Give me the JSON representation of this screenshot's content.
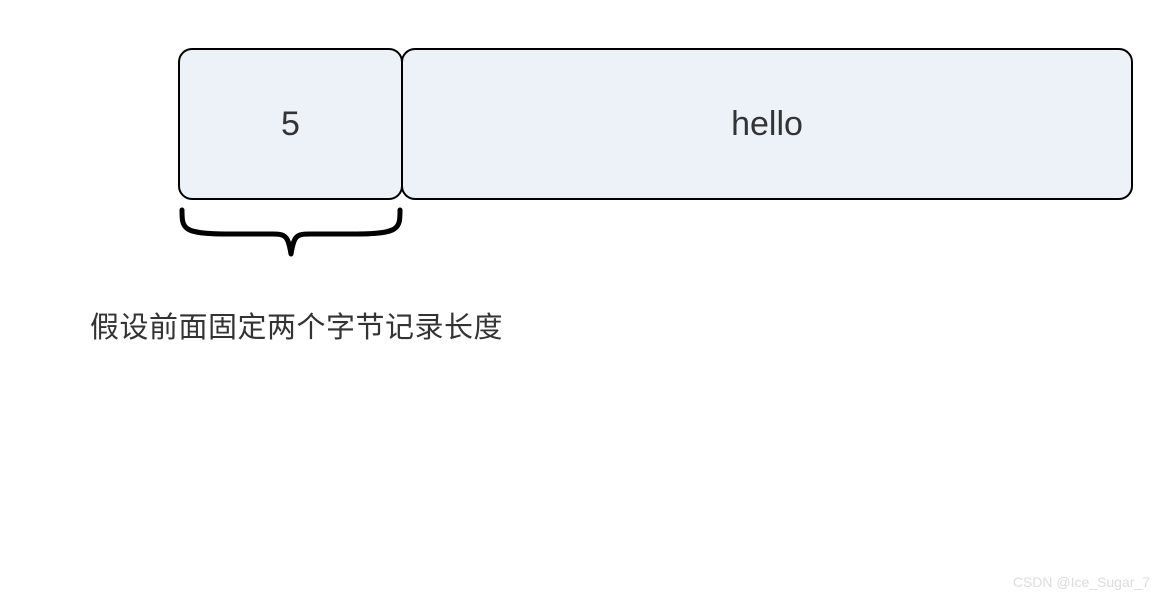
{
  "diagram": {
    "length_box": "5",
    "payload_box": "hello",
    "caption": "假设前面固定两个字节记录长度"
  },
  "watermark": "CSDN @Ice_Sugar_7"
}
